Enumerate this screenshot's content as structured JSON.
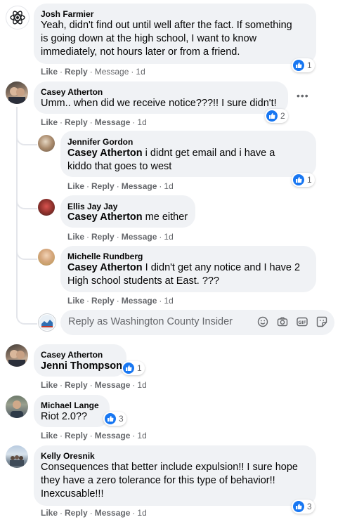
{
  "actions": {
    "like": "Like",
    "reply": "Reply",
    "message": "Message",
    "dot": "·"
  },
  "colors": {
    "brand": "#1877f2",
    "bubble": "#f0f2f5",
    "secondary_text": "#65676b"
  },
  "comments": [
    {
      "author": "Josh Farmier",
      "lines": [
        "Yeah, didn't find out until well after the fact. If something",
        "is going down at the high school, I want to know",
        "immediately, not hours later or from a friend."
      ],
      "time": "1d",
      "reaction_count": "1"
    },
    {
      "author": "Casey Atherton",
      "lines": [
        "Umm.. when did we receive notice???!! I sure didn't!"
      ],
      "time": "1d",
      "reaction_count": "2",
      "replies": [
        {
          "author": "Jennifer Gordon",
          "mention": "Casey Atherton",
          "line1": " i didnt get email and i have a",
          "line2": "kiddo that goes to west",
          "time": "1d",
          "reaction_count": "1"
        },
        {
          "author": "Ellis Jay Jay",
          "mention": "Casey Atherton",
          "line1": " me either",
          "time": "1d"
        },
        {
          "author": "Michelle Rundberg",
          "mention": "Casey Atherton",
          "line1": " I didn't get any notice and I have 2",
          "line2": "High school students at East. ???",
          "time": "1d"
        }
      ],
      "reply_placeholder": "Reply as Washington County Insider"
    },
    {
      "author": "Casey Atherton",
      "mention": "Jenni Thompson",
      "time": "1d",
      "reaction_count": "1"
    },
    {
      "author": "Michael Lange",
      "lines": [
        "Riot 2.0??"
      ],
      "time": "1d",
      "reaction_count": "3"
    },
    {
      "author": "Kelly Oresnik",
      "lines": [
        "Consequences that better include expulsion!! I sure hope",
        "they have a zero tolerance for this type of behavior!!",
        "Inexcusable!!!"
      ],
      "time": "1d",
      "reaction_count": "3"
    }
  ],
  "icons": [
    "like-icon",
    "emoji-icon",
    "camera-icon",
    "gif-icon",
    "sticker-icon",
    "more-options-icon"
  ]
}
